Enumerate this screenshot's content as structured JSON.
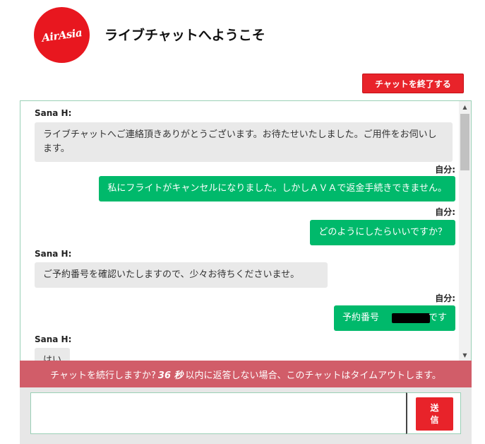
{
  "header": {
    "logo_text": "AirAsia",
    "title": "ライブチャットへようこそ"
  },
  "toolbar": {
    "end_chat_label": "チャットを終了する"
  },
  "messages": [
    {
      "sender": "Sana H:",
      "text": "ライブチャットへご連絡頂きありがとうございます。お待たせいたしました。ご用件をお伺いします。"
    },
    {
      "sender": "自分:",
      "text": "私にフライトがキャンセルになりました。しかしＡＶＡで返金手続きできません。"
    },
    {
      "sender": "自分:",
      "text": "どのようにしたらいいですか？"
    },
    {
      "sender": "Sana H:",
      "text": "ご予約番号を確認いたしますので、少々お待ちくださいませ。"
    },
    {
      "sender": "自分:",
      "text_before": "予約番号",
      "text_after": "です"
    },
    {
      "sender": "Sana H:",
      "text": "はい"
    }
  ],
  "timeout": {
    "prefix": "チャットを続行しますか?",
    "seconds": "36 秒",
    "suffix": "以内に返答しない場合、このチャットはタイムアウトします。"
  },
  "composer": {
    "input_value": "",
    "send_label": "送信"
  },
  "colors": {
    "brand_red": "#e8232a",
    "my_bubble": "#00b96b",
    "agent_bubble": "#e9e9e9",
    "timeout_bar": "#d15d69"
  }
}
